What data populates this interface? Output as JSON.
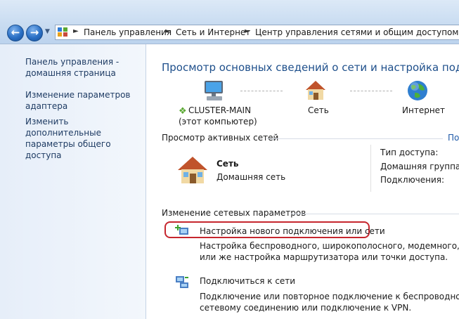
{
  "breadcrumbs": [
    "Панель управления",
    "Сеть и Интернет",
    "Центр управления сетями и общим доступом"
  ],
  "left_pane": {
    "home_link": "Панель управления - домашняя страница",
    "adapter_link": "Изменение параметров адаптера",
    "sharing_link": "Изменить дополнительные параметры общего доступа"
  },
  "main": {
    "heading": "Просмотр основных сведений о сети и настройка подключ",
    "network_map": {
      "computer_name": "CLUSTER-MAIN",
      "computer_note": "(этот компьютер)",
      "network_label": "Сеть",
      "internet_label": "Интернет"
    },
    "active_networks": {
      "title": "Просмотр активных сетей",
      "right_link": "По",
      "network_name": "Сеть",
      "network_type_link": "Домашняя сеть",
      "access_type_label": "Тип доступа:",
      "homegroup_label": "Домашняя группа:",
      "connections_label": "Подключения:"
    },
    "change_settings": {
      "title": "Изменение сетевых параметров",
      "items": [
        {
          "link": "Настройка нового подключения или сети",
          "desc1": "Настройка беспроводного, широкополосного, модемного, прямо",
          "desc2": "или же настройка маршрутизатора или точки доступа."
        },
        {
          "link": "Подключиться к сети",
          "desc1": "Подключение или повторное подключение к беспроводному, про",
          "desc2": "сетевому соединению или подключение к VPN."
        }
      ]
    }
  },
  "colors": {
    "link": "#1f5aa8",
    "heading": "#1e4f8b",
    "highlight": "#c6262e"
  },
  "icons": {
    "back": "back-arrow-icon",
    "forward": "forward-arrow-icon",
    "computer": "computer-icon",
    "house": "house-icon",
    "globe": "globe-icon",
    "new_connection": "new-connection-icon",
    "connect": "connect-network-icon"
  }
}
